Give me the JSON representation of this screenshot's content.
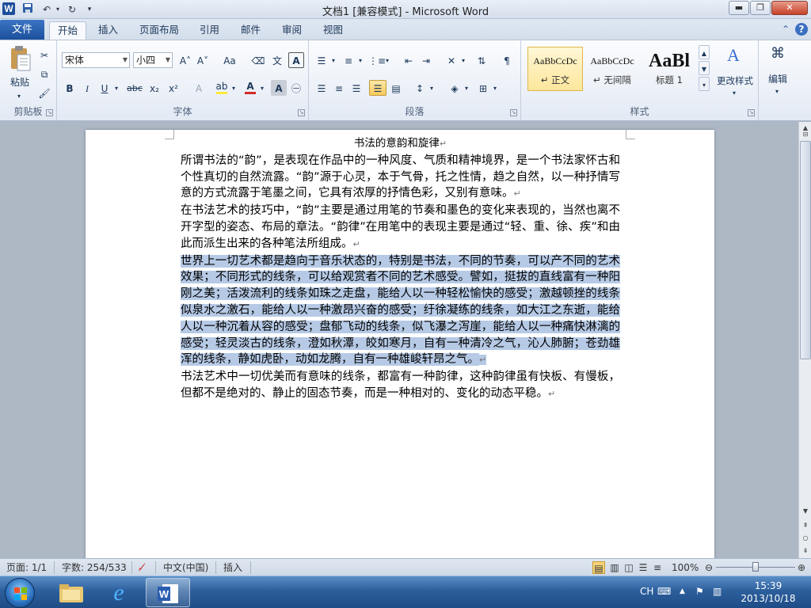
{
  "window": {
    "title": "文档1 [兼容模式] - Microsoft Word",
    "logo": "W",
    "qat": {
      "save_icon": "save-icon",
      "undo_icon": "undo-icon",
      "redo_icon": "redo-icon",
      "customize_icon": "customize-qat-icon"
    },
    "controls": {
      "minimize": "▬",
      "restore": "❐",
      "close": "✕"
    }
  },
  "tabs": {
    "file": "文件",
    "items": [
      "开始",
      "插入",
      "页面布局",
      "引用",
      "邮件",
      "审阅",
      "视图"
    ],
    "active": "开始"
  },
  "ribbon": {
    "clipboard": {
      "label": "剪贴板",
      "paste": "粘贴"
    },
    "font": {
      "label": "字体",
      "font_name": "宋体",
      "font_size": "小四",
      "bold": "B",
      "italic": "I",
      "underline": "U",
      "strikethrough": "abc",
      "subscript": "x₂",
      "superscript": "x²",
      "grow": "A˄",
      "shrink": "A˅",
      "change_case": "Aa",
      "font_color_accent": "#d42a2a",
      "highlight_accent": "#ffeb3b"
    },
    "paragraph": {
      "label": "段落"
    },
    "styles": {
      "label": "样式",
      "items": [
        {
          "sample": "AaBbCcDc",
          "name": "↵ 正文",
          "selected": true
        },
        {
          "sample": "AaBbCcDc",
          "name": "↵ 无间隔",
          "selected": false
        },
        {
          "sample": "AaBl",
          "name": "标题 1",
          "selected": false
        }
      ],
      "change_styles": "更改样式"
    },
    "editing": {
      "label": "编辑"
    }
  },
  "document": {
    "title": "书法的意韵和旋律",
    "paragraphs": [
      {
        "text": "所谓书法的“韵”，是表现在作品中的一种风度、气质和精神境界，是一个书法家怀古和个性真切的自然流露。“韵”源于心灵，本于气骨，托之性情，趋之自然，以一种抒情写意的方式流露于笔墨之间，它具有浓厚的抒情色彩，又别有意味。",
        "highlighted": false
      },
      {
        "text": "在书法艺术的技巧中，“韵”主要是通过用笔的节奏和墨色的变化来表现的，当然也离不开字型的姿态、布局的章法。“韵律”在用笔中的表现主要是通过“轻、重、徐、疾”和由此而派生出来的各种笔法所组成。",
        "highlighted": false
      },
      {
        "text": "世界上一切艺术都是趋向于音乐状态的，特别是书法，不同的节奏，可以产不同的艺术效果；不同形式的线条，可以给观赏者不同的艺术感受。譬如，挺拔的直线富有一种阳刚之美；活泼流利的线条如珠之走盘，能给人以一种轻松愉快的感受；激越顿挫的线条似泉水之激石，能给人以一种激昂兴奋的感受；纡徐凝练的线条，如大江之东逝，能给人以一种沉着从容的感受；盘郁飞动的线条，似飞瀑之泻崖，能给人以一种痛快淋漓的感受；轻灵淡古的线条，澄如秋潭，皎如寒月，自有一种清冷之气，沁人肺腑；苍劲雄浑的线条，静如虎卧，动如龙腾，自有一种雄峻轩昂之气。",
        "highlighted": true
      },
      {
        "text": "书法艺术中一切优美而有意味的线条，都富有一种韵律，这种韵律虽有快板、有慢板，但都不是绝对的、静止的固态节奏，而是一种相对的、变化的动态平稳。",
        "highlighted": false
      }
    ],
    "paragraph_mark": "↵"
  },
  "statusbar": {
    "page": "页面: 1/1",
    "words": "字数: 254/533",
    "language": "中文(中国)",
    "mode": "插入",
    "zoom": "100%"
  },
  "taskbar": {
    "items": [
      "explorer-icon",
      "internet-explorer-icon",
      "word-icon"
    ],
    "ime": "CH",
    "time": "15:39",
    "date": "2013/10/18"
  }
}
